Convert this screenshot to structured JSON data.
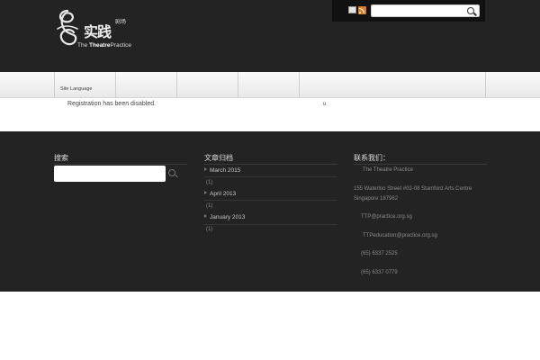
{
  "header": {
    "logo": {
      "cn": "实践",
      "cn_small": "剧场",
      "en_prefix": "The ",
      "en_bold": "Theatre",
      "en_suffix": "Practice"
    },
    "topbar": {
      "icons": [
        "email-icon",
        "rss-icon"
      ],
      "search_placeholder": "",
      "search_icon": "search-icon"
    }
  },
  "nav": {
    "items": [
      {
        "label": "Site Language"
      },
      {
        "label": ""
      },
      {
        "label": ""
      },
      {
        "label": ""
      },
      {
        "label": ""
      },
      {
        "label": ""
      }
    ]
  },
  "content": {
    "message": "Registration has been disabled.",
    "mark": "u"
  },
  "footer": {
    "search": {
      "title": "搜索",
      "placeholder": ""
    },
    "archives": {
      "title": "文章归档",
      "items": [
        {
          "label": "March 2015",
          "count": "(1)"
        },
        {
          "label": "April 2013",
          "count": "(1)"
        },
        {
          "label": "January 2013",
          "count": "(1)"
        }
      ]
    },
    "contact": {
      "title": "联系我们：",
      "name": "The Theatre Practice",
      "address_1": "155 Waterloo Street #02-08 Stamford Arts Centre",
      "address_2": "Singapore 187962",
      "email_1": "TTP@practice.org.sg",
      "email_2": "TTPeducation@practice.org.sg",
      "phone": "(65) 6337 2525",
      "fax": "(65) 6337 0779"
    }
  }
}
